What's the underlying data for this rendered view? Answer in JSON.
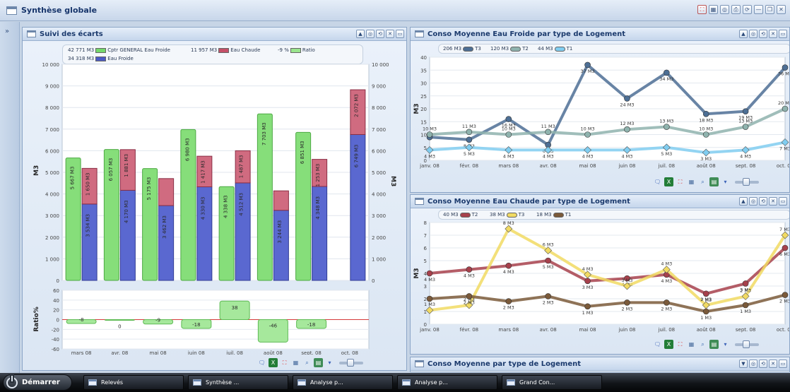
{
  "window": {
    "title": "Synthèse globale"
  },
  "sidebar": {
    "expand_icon": "»"
  },
  "panels": {
    "ecarts": {
      "title": "Suivi des écarts",
      "legend": {
        "items": [
          {
            "value": "42 771 M3",
            "label": "Cptr GENERAL Eau Froide",
            "color": "#74d86a"
          },
          {
            "value": "11 957 M3",
            "label": "Eau Chaude",
            "color": "#c55068"
          },
          {
            "value": "-9 %",
            "label": "Ratio",
            "color": "#9ae58e"
          },
          {
            "value": "34 318 M3",
            "label": "Eau Froide",
            "color": "#4b59c4"
          }
        ]
      },
      "ylabel_left": "M3",
      "ylabel_right": "M3",
      "ratio_ylabel": "Ratio%"
    },
    "froide": {
      "title": "Conso Moyenne Eau Froide par type de Logement",
      "ylabel": "M3",
      "legend": [
        {
          "value": "206 M3",
          "label": "T3",
          "color": "#4d6f95"
        },
        {
          "value": "120 M3",
          "label": "T2",
          "color": "#8fb3ae"
        },
        {
          "value": "44 M3",
          "label": "T1",
          "color": "#80cdf0"
        }
      ]
    },
    "chaude": {
      "title": "Conso Moyenne Eau Chaude par type de Logement",
      "ylabel": "M3",
      "legend": [
        {
          "value": "40 M3",
          "label": "T2",
          "color": "#a7414c"
        },
        {
          "value": "38 M3",
          "label": "T3",
          "color": "#f1da63"
        },
        {
          "value": "18 M3",
          "label": "T1",
          "color": "#7b5a3a"
        }
      ]
    },
    "moyenne": {
      "title": "Conso Moyenne par type de Logement"
    }
  },
  "panel_buttons": [
    "▲",
    "◎",
    "⟲",
    "✕",
    "▭"
  ],
  "panel_buttons_last": [
    "▼",
    "◎",
    "⟲",
    "✕",
    "▭"
  ],
  "taskbar": {
    "start": "Démarrer",
    "tasks": [
      "Relevés",
      "Synthèse ...",
      "Analyse p...",
      "Analyse p...",
      "Grand Con..."
    ]
  },
  "icons": {
    "title_right": [
      "pdf-icon",
      "grid-icon",
      "globe-icon",
      "print-icon",
      "refresh-icon",
      "minimize-icon",
      "restore-icon",
      "close-icon"
    ],
    "tools": [
      "chat-icon",
      "excel-icon",
      "pdf-icon",
      "table-icon",
      "zoom-icon",
      "chart-icon",
      "menu-icon"
    ]
  },
  "chart_data": [
    {
      "type": "bar",
      "title": "Suivi des écarts",
      "ylabel": "M3",
      "categories": [
        "mars 08",
        "avr. 08",
        "mai 08",
        "juin 08",
        "juil. 08",
        "août 08",
        "sept. 08",
        "oct. 08"
      ],
      "ylim": [
        0,
        10000
      ],
      "yticks": [
        "0",
        "1 000",
        "2 000",
        "3 000",
        "4 000",
        "5 000",
        "6 000",
        "7 000",
        "8 000",
        "9 000",
        "10 000"
      ],
      "series": [
        {
          "name": "Cptr GENERAL Eau Froide",
          "values": [
            5667,
            6057,
            5175,
            6980,
            4338,
            7703,
            6851,
            null
          ],
          "labels": [
            "5 667 M3",
            "6 057 M3",
            "5 175 M3",
            "6 980 M3",
            "4 338 M3",
            "7 703 M3",
            "6 851 M3",
            ""
          ]
        },
        {
          "name": "Eau Froide",
          "values": [
            3534,
            4170,
            3462,
            4330,
            4512,
            3244,
            4348,
            6749
          ],
          "labels": [
            "3 534 M3",
            "4 170 M3",
            "3 462 M3",
            "4 330 M3",
            "4 512 M3",
            "3 244 M3",
            "4 348 M3",
            "6 749 M3"
          ]
        },
        {
          "name": "Eau Chaude",
          "values": [
            1650,
            1881,
            1250,
            1417,
            1487,
            900,
            1253,
            2072
          ],
          "labels": [
            "1 650 M3",
            "1 881 M3",
            "",
            "1 417 M3",
            "1 487 M3",
            "",
            "1 253 M3",
            "2 072 M3"
          ]
        }
      ]
    },
    {
      "type": "bar",
      "title": "Ratio",
      "ylabel": "Ratio%",
      "categories": [
        "mars 08",
        "avr. 08",
        "mai 08",
        "juin 08",
        "juil. 08",
        "août 08",
        "sept. 08",
        "oct. 08"
      ],
      "ylim": [
        -60,
        60
      ],
      "yticks": [
        "-60",
        "-40",
        "-20",
        "0",
        "20",
        "40",
        "60"
      ],
      "values": [
        -8,
        0,
        -9,
        -18,
        38,
        -46,
        -18,
        null
      ],
      "labels": [
        "-8",
        "0",
        "-9",
        "-18",
        "38",
        "-46",
        "-18",
        ""
      ]
    },
    {
      "type": "line",
      "title": "Conso Moyenne Eau Froide par type de Logement",
      "ylabel": "M3",
      "categories": [
        "janv. 08",
        "févr. 08",
        "mars 08",
        "avr. 08",
        "mai 08",
        "juin 08",
        "juil. 08",
        "août 08",
        "sept. 08",
        "oct. 08"
      ],
      "yticks": [
        "0",
        "5",
        "10",
        "15",
        "20",
        "25",
        "30",
        "35",
        "40"
      ],
      "series": [
        {
          "name": "T3",
          "values": [
            9,
            8,
            16,
            6,
            37,
            24,
            34,
            18,
            19,
            36
          ],
          "labels": [
            "",
            "8 M3",
            "16 M3",
            "6 M3",
            "37 M3",
            "24 M3",
            "34 M3",
            "18 M3",
            "19 M3",
            "36 M3"
          ]
        },
        {
          "name": "T2",
          "values": [
            10,
            11,
            10,
            11,
            10,
            12,
            13,
            10,
            13,
            20
          ],
          "labels": [
            "10 M3",
            "11 M3",
            "10 M3",
            "11 M3",
            "10 M3",
            "12 M3",
            "13 M3",
            "10 M3",
            "13 M3",
            "20 M3"
          ]
        },
        {
          "name": "T1",
          "values": [
            4,
            5,
            4,
            4,
            4,
            4,
            5,
            3,
            4,
            7
          ],
          "labels": [
            "4 M3",
            "5 M3",
            "4 M3",
            "4 M3",
            "4 M3",
            "4 M3",
            "5 M3",
            "3 M3",
            "4 M3",
            "7 M3"
          ]
        }
      ]
    },
    {
      "type": "line",
      "title": "Conso Moyenne Eau Chaude par type de Logement",
      "ylabel": "M3",
      "categories": [
        "janv. 08",
        "févr. 08",
        "mars 08",
        "avr. 08",
        "mai 08",
        "juin 08",
        "juil. 08",
        "août 08",
        "sept. 08",
        "oct. 08"
      ],
      "ylim": [
        0,
        8
      ],
      "yticks": [
        "0",
        "1",
        "2",
        "3",
        "4",
        "5",
        "6",
        "7",
        "8"
      ],
      "series": [
        {
          "name": "T2",
          "values": [
            4,
            4.3,
            4.6,
            5,
            3.4,
            3.6,
            3.9,
            2.4,
            3.2,
            6
          ],
          "labels": [
            "4 M3",
            "4 M3",
            "4 M3",
            "5 M3",
            "3 M3",
            "4 M3",
            "4 M3",
            "2 M3",
            "3 M3",
            "6 M3"
          ]
        },
        {
          "name": "T3",
          "values": [
            1.1,
            1.5,
            7.5,
            5.8,
            3.9,
            3,
            4.3,
            1.5,
            2.2,
            7
          ],
          "labels": [
            "1 M3",
            "2 M3",
            "8 M3",
            "6 M3",
            "4 M3",
            "3 M3",
            "4 M3",
            "2 M3",
            "2 M3",
            "7 M3"
          ]
        },
        {
          "name": "T1",
          "values": [
            2,
            2.2,
            1.8,
            2.2,
            1.4,
            1.7,
            1.7,
            1,
            1.5,
            2.3
          ],
          "labels": [
            "",
            "2 M3",
            "2 M3",
            "2 M3",
            "1 M3",
            "2 M3",
            "2 M3",
            "1 M3",
            "1 M3",
            "2 M3"
          ]
        }
      ]
    }
  ]
}
